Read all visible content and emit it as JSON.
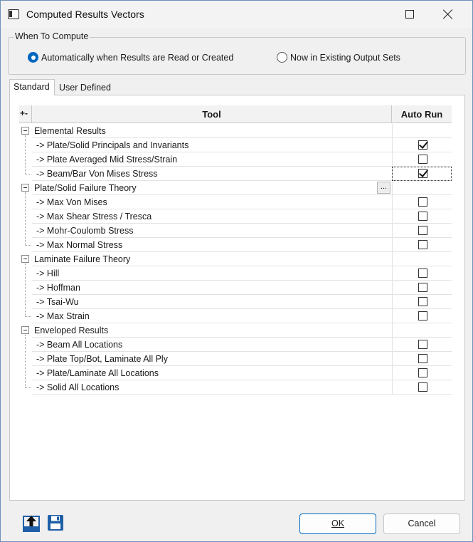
{
  "window": {
    "title": "Computed Results Vectors"
  },
  "when_to_compute": {
    "label": "When To Compute",
    "options": [
      {
        "label": "Automatically when Results are Read or Created",
        "selected": true
      },
      {
        "label": "Now in Existing Output Sets",
        "selected": false
      }
    ]
  },
  "tabs": [
    {
      "label": "Standard",
      "active": true
    },
    {
      "label": "User Defined",
      "active": false
    }
  ],
  "grid": {
    "expand_collapse_label": "+-",
    "col_tool": "Tool",
    "col_auto_run": "Auto Run",
    "ellipsis_label": "...",
    "groups": [
      {
        "label": "Elemental Results",
        "items": [
          {
            "label": "-> Plate/Solid Principals and Invariants",
            "checked": true
          },
          {
            "label": "-> Plate Averaged Mid Stress/Strain",
            "checked": false
          },
          {
            "label": "-> Beam/Bar Von Mises Stress",
            "checked": true,
            "focused": true
          }
        ]
      },
      {
        "label": "Plate/Solid Failure Theory",
        "has_ellipsis": true,
        "items": [
          {
            "label": "-> Max Von Mises",
            "checked": false
          },
          {
            "label": "-> Max Shear Stress / Tresca",
            "checked": false
          },
          {
            "label": "-> Mohr-Coulomb Stress",
            "checked": false
          },
          {
            "label": "-> Max Normal Stress",
            "checked": false
          }
        ]
      },
      {
        "label": "Laminate Failure Theory",
        "items": [
          {
            "label": "-> Hill",
            "checked": false
          },
          {
            "label": "-> Hoffman",
            "checked": false
          },
          {
            "label": "-> Tsai-Wu",
            "checked": false
          },
          {
            "label": "-> Max Strain",
            "checked": false
          }
        ]
      },
      {
        "label": "Enveloped Results",
        "items": [
          {
            "label": "-> Beam All Locations",
            "checked": false
          },
          {
            "label": "-> Plate Top/Bot, Laminate All Ply",
            "checked": false
          },
          {
            "label": "-> Plate/Laminate All Locations",
            "checked": false
          },
          {
            "label": "-> Solid All Locations",
            "checked": false
          }
        ]
      }
    ]
  },
  "footer": {
    "load_icon": "upload-icon",
    "save_icon": "save-disk-icon",
    "ok_label": "OK",
    "cancel_label": "Cancel"
  },
  "colors": {
    "accent": "#0067c0",
    "save_icon_blue": "#1f5fa8"
  }
}
